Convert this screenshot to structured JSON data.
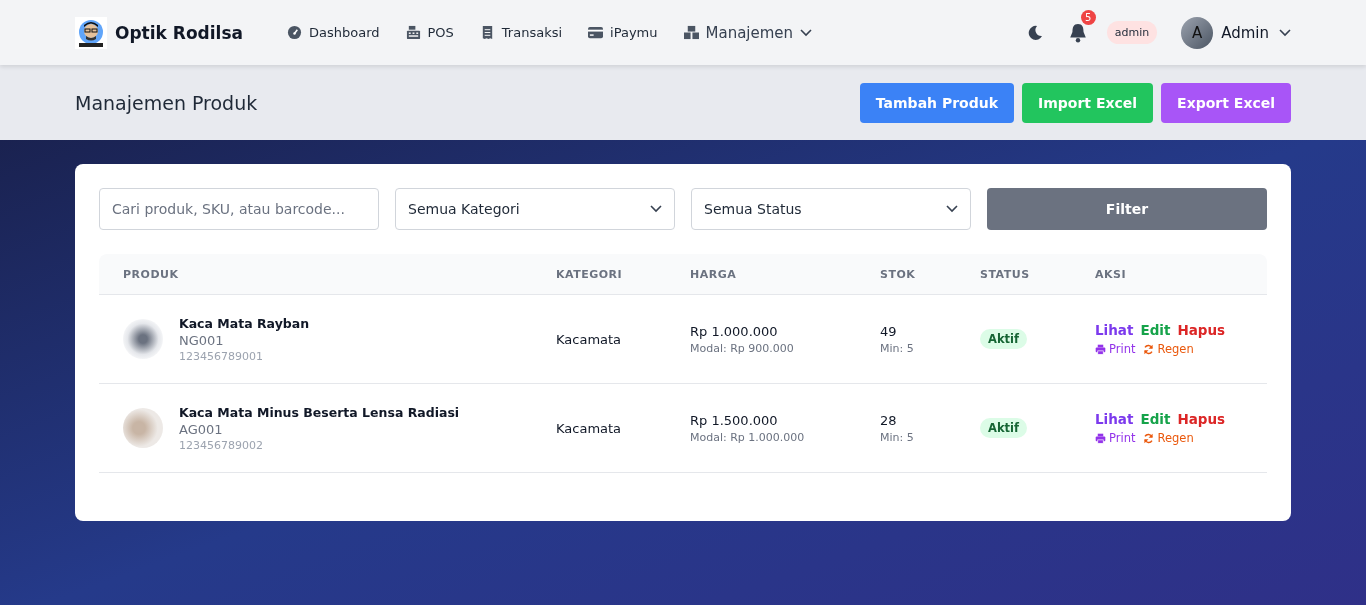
{
  "brand": {
    "name": "Optik Rodilsa"
  },
  "nav": [
    {
      "label": "Dashboard",
      "kind": "gauge",
      "dropdown": false
    },
    {
      "label": "POS",
      "kind": "register",
      "dropdown": false
    },
    {
      "label": "Transaksi",
      "kind": "receipt",
      "dropdown": false
    },
    {
      "label": "iPaymu",
      "kind": "card",
      "dropdown": false
    },
    {
      "label": "Manajemen",
      "kind": "boxes",
      "dropdown": true
    }
  ],
  "notifications": {
    "count": "5"
  },
  "role_badge": "admin",
  "user": {
    "initial": "A",
    "name": "Admin"
  },
  "page_title": "Manajemen Produk",
  "actions": [
    {
      "label": "Tambah Produk",
      "color": "#3b82f6"
    },
    {
      "label": "Import Excel",
      "color": "#22c55e"
    },
    {
      "label": "Export Excel",
      "color": "#a855f7"
    }
  ],
  "filters": {
    "search_placeholder": "Cari produk, SKU, atau barcode...",
    "category": "Semua Kategori",
    "status": "Semua Status",
    "button": "Filter"
  },
  "table": {
    "columns": [
      "PRODUK",
      "KATEGORI",
      "HARGA",
      "STOK",
      "STATUS",
      "AKSI"
    ],
    "rows": [
      {
        "name": "Kaca Mata Rayban",
        "sku": "NG001",
        "barcode": "123456789001",
        "category": "Kacamata",
        "price": "Rp 1.000.000",
        "cost": "Modal: Rp 900.000",
        "stock": "49",
        "min_stock": "Min: 5",
        "status": "Aktif",
        "active": true,
        "actions": [
          "Lihat",
          "Edit",
          "Hapus"
        ],
        "print": "Print",
        "regen": "Regen"
      },
      {
        "name": "Kaca Mata Minus Beserta Lensa Radiasi",
        "sku": "AG001",
        "barcode": "123456789002",
        "category": "Kacamata",
        "price": "Rp 1.500.000",
        "cost": "Modal: Rp 1.000.000",
        "stock": "28",
        "min_stock": "Min: 5",
        "status": "Aktif",
        "active": true,
        "actions": [
          "Lihat",
          "Edit",
          "Hapus"
        ],
        "print": "Print",
        "regen": "Regen"
      }
    ]
  }
}
